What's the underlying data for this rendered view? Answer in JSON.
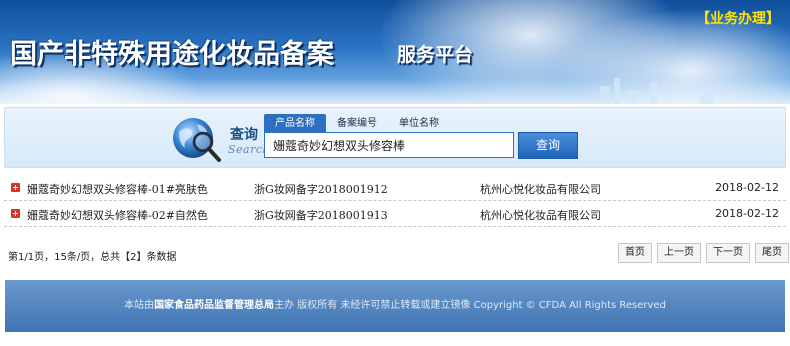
{
  "header": {
    "title": "国产非特殊用途化妆品备案",
    "subtitle": "服务平台",
    "business_link": "【业务办理】"
  },
  "search": {
    "label": "查询",
    "label_en": "Search",
    "tabs": [
      {
        "label": "产品名称",
        "active": true
      },
      {
        "label": "备案编号",
        "active": false
      },
      {
        "label": "单位名称",
        "active": false
      }
    ],
    "query": "姗蔻奇妙幻想双头修容棒",
    "button_label": "查询"
  },
  "results": [
    {
      "name": "姗蔻奇妙幻想双头修容棒-01#亮肤色",
      "registration": "浙G妆网备字2018001912",
      "company": "杭州心悦化妆品有限公司",
      "date": "2018-02-12"
    },
    {
      "name": "姗蔻奇妙幻想双头修容棒-02#自然色",
      "registration": "浙G妆网备字2018001913",
      "company": "杭州心悦化妆品有限公司",
      "date": "2018-02-12"
    }
  ],
  "pagination": {
    "info": "第1/1页，15条/页，总共【2】条数据",
    "first": "首页",
    "prev": "上一页",
    "next": "下一页",
    "last": "尾页"
  },
  "footer": {
    "prefix": "本站由",
    "owner": "国家食品药品监督管理总局",
    "suffix": "主办 版权所有 未经许可禁止转载或建立镜像 Copyright © CFDA All Rights Reserved"
  },
  "colors": {
    "accent": "#2d6fc0",
    "link_yellow": "#ffe400",
    "marker_red": "#d7342a",
    "footer_blue": "#4f82bf"
  }
}
